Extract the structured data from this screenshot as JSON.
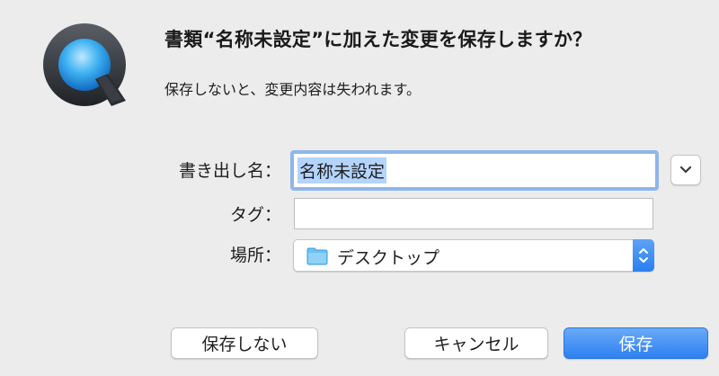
{
  "dialog": {
    "title": "書類“名称未設定”に加えた変更を保存しますか？",
    "message": "保存しないと、変更内容は失われます。"
  },
  "app_icon": "quicktime-icon",
  "form": {
    "name_label": "書き出し名：",
    "name_value": "名称未設定",
    "tags_label": "タグ：",
    "tags_value": "",
    "where_label": "場所：",
    "where_value": "デスクトップ",
    "where_icon": "folder-icon",
    "expand_icon": "chevron-down-icon"
  },
  "buttons": {
    "dont_save": "保存しない",
    "cancel": "キャンセル",
    "save": "保存"
  },
  "colors": {
    "accent": "#2d80f1",
    "focus_ring": "#8fb6ea",
    "selection": "#b4d4fd",
    "folder": "#6cc1f2"
  }
}
